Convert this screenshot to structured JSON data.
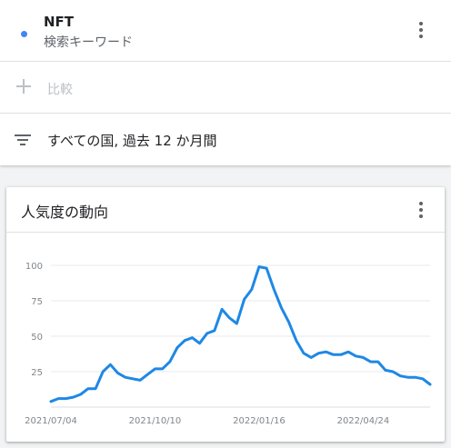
{
  "search_term": {
    "name": "NFT",
    "type_label": "検索キーワード",
    "color": "#4285f4"
  },
  "compare": {
    "label": "比較"
  },
  "filter": {
    "label": "すべての国, 過去 12 か月間"
  },
  "card": {
    "title": "人気度の動向"
  },
  "icons": {
    "term_menu": "more-vert-icon",
    "compare": "plus-icon",
    "filter": "filter-list-icon",
    "card_menu": "more-vert-icon"
  },
  "chart_data": {
    "type": "line",
    "title": "",
    "xlabel": "",
    "ylabel": "",
    "ylim": [
      0,
      100
    ],
    "yticks": [
      25,
      50,
      75,
      100
    ],
    "x_tick_labels": [
      "2021/07/04",
      "2021/10/10",
      "2022/01/16",
      "2022/04/24"
    ],
    "x_tick_indices": [
      0,
      14,
      28,
      42
    ],
    "grid": true,
    "line_color": "#1e88e5",
    "series": [
      {
        "name": "NFT",
        "values": [
          4,
          6,
          6,
          7,
          9,
          13,
          13,
          25,
          30,
          24,
          21,
          20,
          19,
          23,
          27,
          27,
          32,
          42,
          47,
          49,
          45,
          52,
          54,
          69,
          63,
          59,
          76,
          83,
          99,
          98,
          83,
          70,
          60,
          47,
          38,
          35,
          38,
          39,
          37,
          37,
          39,
          36,
          35,
          32,
          32,
          26,
          25,
          22,
          21,
          21,
          20,
          16
        ]
      }
    ]
  }
}
